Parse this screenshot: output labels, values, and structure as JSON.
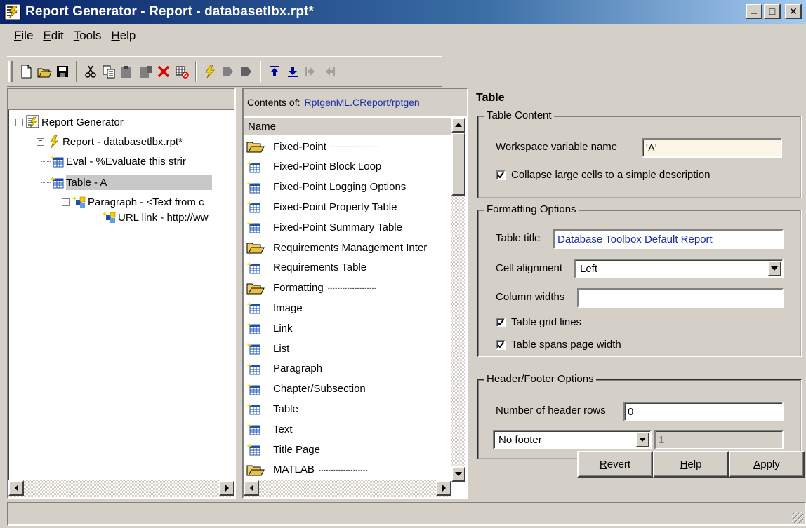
{
  "window": {
    "title": "Report Generator - Report - databasetlbx.rpt*",
    "min_glyph": "_",
    "max_glyph": "□",
    "close_glyph": "✕"
  },
  "menu": [
    {
      "label_first": "F",
      "label_rest": "ile"
    },
    {
      "label_first": "E",
      "label_rest": "dit"
    },
    {
      "label_first": "T",
      "label_rest": "ools"
    },
    {
      "label_first": "H",
      "label_rest": "elp"
    }
  ],
  "toolbar": {
    "icons": [
      "new-icon",
      "open-icon",
      "save-icon",
      "cut-icon",
      "copy-icon",
      "paste-icon",
      "paste-disabled-icon",
      "delete-icon",
      "disable-icon",
      "generate-icon",
      "move-left-icon",
      "move-right-icon",
      "move-up-icon",
      "move-down-icon",
      "demote-icon",
      "promote-icon"
    ]
  },
  "tree": {
    "items": [
      {
        "label": "Report Generator",
        "icon": "report-generator-icon"
      },
      {
        "label": "Report - databasetlbx.rpt*",
        "icon": "report-icon"
      },
      {
        "label": "Eval - %Evaluate this strir",
        "icon": "table-component-icon"
      },
      {
        "label": "Table - A",
        "icon": "table-component-icon"
      },
      {
        "label": "Paragraph - <Text from c",
        "icon": "paragraph-icon"
      },
      {
        "label": "URL link - http://ww",
        "icon": "paragraph-icon"
      }
    ],
    "expander_symbol": "−"
  },
  "list": {
    "contents_label": "Contents of:",
    "contents_path": "RptgenML.CReport/rptgen",
    "column_header": "Name",
    "items": [
      {
        "label": "Fixed-Point",
        "type": "category",
        "dashes": "- - - - - - - - - - - - - - - - - - - -"
      },
      {
        "label": "Fixed-Point Block Loop",
        "type": "component"
      },
      {
        "label": "Fixed-Point Logging Options",
        "type": "component"
      },
      {
        "label": "Fixed-Point Property Table",
        "type": "component"
      },
      {
        "label": "Fixed-Point Summary Table",
        "type": "component"
      },
      {
        "label": "Requirements Management Inter",
        "type": "category",
        "dashes": ""
      },
      {
        "label": "Requirements Table",
        "type": "component"
      },
      {
        "label": "Formatting",
        "type": "category",
        "dashes": "- - - - - - - - - - - - - - - - - - - -"
      },
      {
        "label": "Image",
        "type": "component"
      },
      {
        "label": "Link",
        "type": "component"
      },
      {
        "label": "List",
        "type": "component"
      },
      {
        "label": "Paragraph",
        "type": "component"
      },
      {
        "label": "Chapter/Subsection",
        "type": "component"
      },
      {
        "label": "Table",
        "type": "component"
      },
      {
        "label": "Text",
        "type": "component"
      },
      {
        "label": "Title Page",
        "type": "component"
      },
      {
        "label": "MATLAB",
        "type": "category",
        "dashes": "- - - - - - - - - - - - - - - - - - - -"
      }
    ]
  },
  "props": {
    "title": "Table",
    "table_content": {
      "legend": "Table Content",
      "workspace_label": "Workspace variable name",
      "workspace_value": "'A'",
      "collapse_label": "Collapse large cells to a simple description",
      "collapse_checked": true
    },
    "formatting": {
      "legend": "Formatting Options",
      "title_label": "Table title",
      "title_value": "Database Toolbox Default Report",
      "alignment_label": "Cell alignment",
      "alignment_value": "Left",
      "widths_label": "Column widths",
      "widths_value": "",
      "grid_label": "Table grid lines",
      "grid_checked": true,
      "spans_label": "Table spans page width",
      "spans_checked": true
    },
    "header_footer": {
      "legend": "Header/Footer Options",
      "header_rows_label": "Number of header rows",
      "header_rows_value": "0",
      "footer_select_value": "No footer",
      "footer_rows_value": "1"
    },
    "buttons": {
      "revert_first": "R",
      "revert_rest": "evert",
      "help_first": "H",
      "help_rest": "elp",
      "apply_first": "A",
      "apply_rest": "pply"
    }
  },
  "colors": {
    "titlebar_start": "#0a246a",
    "titlebar_end": "#a6caf0",
    "face": "#d4d0c8",
    "link_text": "#1a2fa8",
    "input_highlight": "#fdf5e6"
  }
}
